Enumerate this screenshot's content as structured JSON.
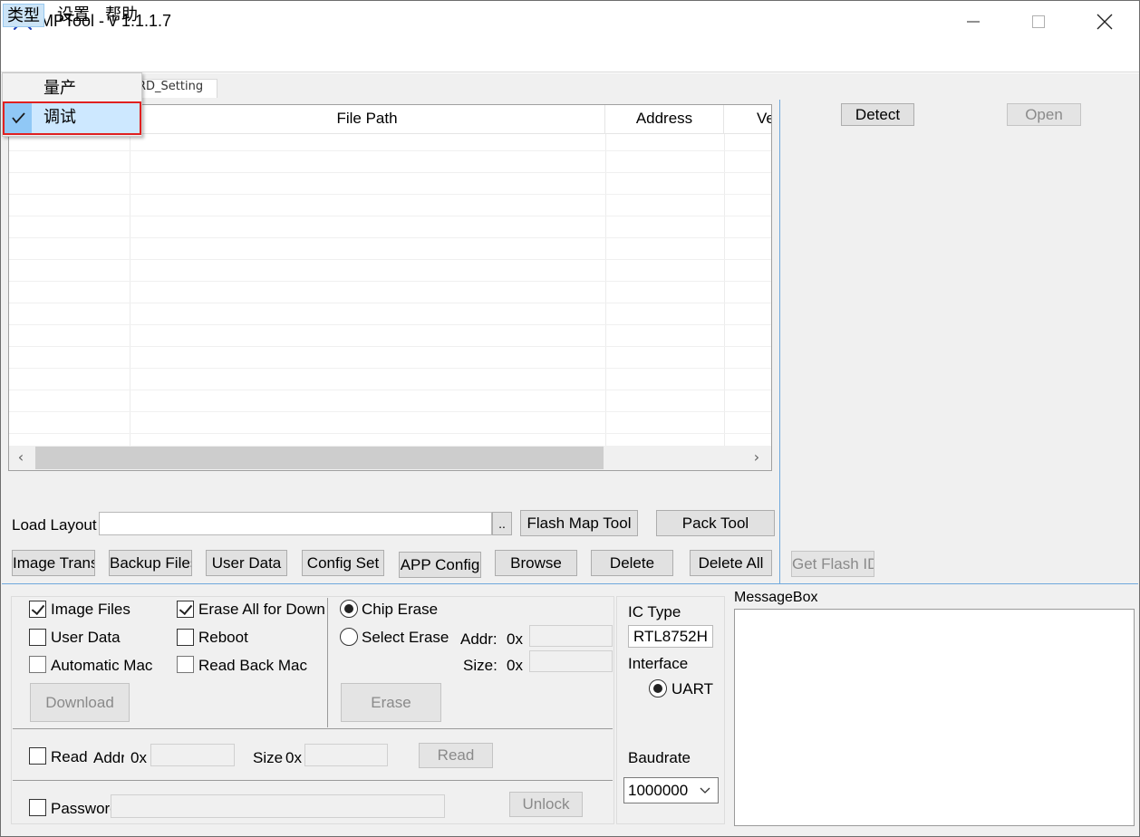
{
  "window": {
    "title": "MPTool - v 1.1.1.7",
    "logo_icon": "realtek-crab-icon",
    "controls": [
      "minimize-icon",
      "maximize-icon",
      "close-icon"
    ]
  },
  "menubar": {
    "items": [
      {
        "label": "类型"
      },
      {
        "label": "设置"
      },
      {
        "label": "帮助"
      }
    ]
  },
  "dropdown": {
    "items": [
      {
        "label": "量产",
        "checked": false
      },
      {
        "label": "调试",
        "checked": true
      }
    ],
    "highlight_color": "#e02020"
  },
  "tabs": {
    "partial_label": "RD_Setting"
  },
  "table": {
    "columns": [
      "",
      "File Path",
      "Address",
      "Ve"
    ]
  },
  "toolbar": {
    "load_layout_label": "Load Layout",
    "load_layout_value": "",
    "browse_dots": "..",
    "flash_map_tool": "Flash Map Tool",
    "pack_tool": "Pack Tool",
    "image_trans": "Image Trans",
    "backup_files": "Backup Files",
    "user_data": "User Data",
    "config_set": "Config Set",
    "app_config": "APP Config",
    "browse": "Browse",
    "delete": "Delete",
    "delete_all": "Delete All"
  },
  "right_panel": {
    "detect": "Detect",
    "open": "Open",
    "get_flash_id": "Get Flash ID"
  },
  "download_group": {
    "image_files": {
      "label": "Image Files",
      "checked": true
    },
    "user_data": {
      "label": "User Data",
      "checked": false
    },
    "automatic_mac": {
      "label": "Automatic Mac",
      "checked": false
    },
    "erase_all": {
      "label": "Erase All for Down",
      "checked": true
    },
    "reboot": {
      "label": "Reboot",
      "checked": false
    },
    "read_back_mac": {
      "label": "Read Back Mac",
      "checked": false
    },
    "download": "Download"
  },
  "erase_group": {
    "chip_erase": {
      "label": "Chip Erase",
      "selected": true
    },
    "select_erase": {
      "label": "Select Erase",
      "selected": false
    },
    "addr_label": "Addr:",
    "size_label": "Size:",
    "hex_prefix": "0x",
    "erase": "Erase"
  },
  "read_group": {
    "read_label": "Read",
    "addr_label": "Addr",
    "hex_prefix": "0x",
    "size_label": "Size",
    "read_button": "Read"
  },
  "password_group": {
    "label": "Password",
    "unlock": "Unlock"
  },
  "ic_group": {
    "ic_type_label": "IC Type",
    "ic_type_value": "RTL8752H",
    "interface_label": "Interface",
    "uart_label": "UART",
    "uart_selected": true,
    "baudrate_label": "Baudrate",
    "baudrate_value": "1000000"
  },
  "messagebox": {
    "label": "MessageBox",
    "content": ""
  }
}
